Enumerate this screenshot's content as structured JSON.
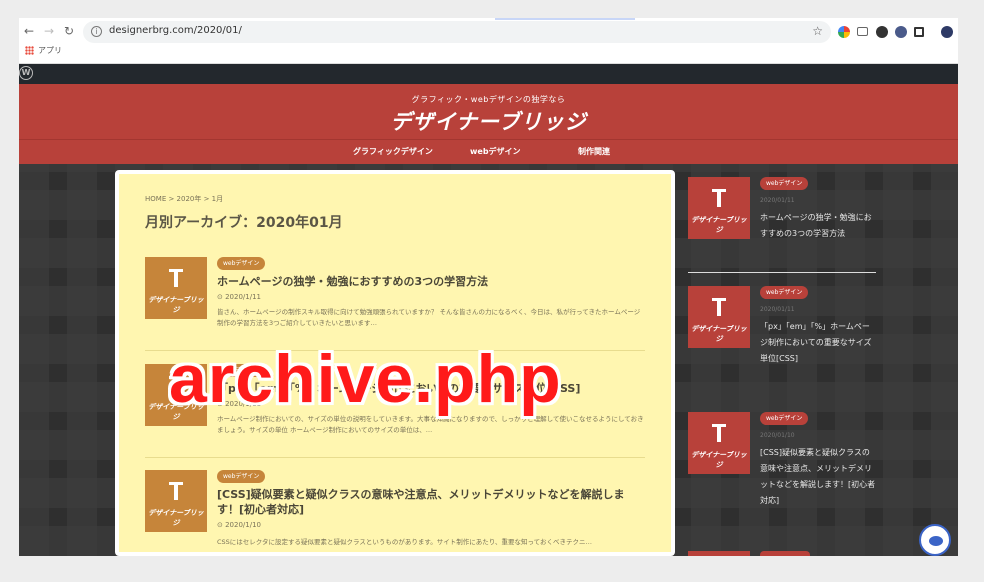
{
  "browser": {
    "url": "designerbrg.com/2020/01/",
    "bookmark_apps": "アプリ"
  },
  "site": {
    "tagline": "グラフィック・webデザインの独学なら",
    "logo": "デザイナーブリッジ",
    "nav": [
      "グラフィックデザイン",
      "webデザイン",
      "制作関連"
    ]
  },
  "main": {
    "breadcrumb": "HOME > 2020年 > 1月",
    "archive_title": "月別アーカイブ：2020年01月",
    "posts": [
      {
        "category": "webデザイン",
        "title": "ホームページの独学・勉強におすすめの3つの学習方法",
        "date": "2020/1/11",
        "excerpt": "皆さん、ホームページの制作スキル取得に向けて勉強頑張られていますか？ そんな皆さんの力になるべく、今日は、私が行ってきたホームページ制作の学習方法を3つご紹介していきたいと思います…",
        "thumb_brand": "デザイナーブリッジ"
      },
      {
        "category": "webデザイン",
        "title": "「px」「em」「%」ホームページ制作においての重要なサイズ単位[CSS]",
        "date": "2020/1/11",
        "excerpt": "ホームページ制作においての、サイズの単位の説明をしていきます。大事な知識になりますので、しっかりと理解して使いこなせるようにしておきましょう。サイズの単位 ホームページ制作においてのサイズの単位は、…",
        "thumb_brand": "デザイナーブリッジ"
      },
      {
        "category": "webデザイン",
        "title": "[CSS]疑似要素と疑似クラスの意味や注意点、メリットデメリットなどを解説します！[初心者対応]",
        "date": "2020/1/10",
        "excerpt": "CSSにはセレクタに設定する疑似要素と疑似クラスというものがあります。サイト制作にあたり、重要な知っておくべきテクニ…",
        "thumb_brand": "デザイナーブリッジ"
      }
    ]
  },
  "overlay_text": "archive.php",
  "sidebar": {
    "items": [
      {
        "category": "webデザイン",
        "date": "2020/01/11",
        "title": "ホームページの独学・勉強におすすめの3つの学習方法",
        "thumb_brand": "デザイナーブリッジ"
      },
      {
        "category": "webデザイン",
        "date": "2020/01/11",
        "title": "「px」「em」「%」ホームページ制作においての重要なサイズ単位[CSS]",
        "thumb_brand": "デザイナーブリッジ"
      },
      {
        "category": "webデザイン",
        "date": "2020/01/10",
        "title": "[CSS]疑似要素と疑似クラスの意味や注意点、メリットデメリットなどを解説します！[初心者対応]",
        "thumb_brand": "デザイナーブリッジ"
      }
    ]
  },
  "colors": {
    "header_red": "#b8413a",
    "main_bg": "#fff6b0",
    "thumb_orange": "#c6853a",
    "overlay_red": "#ff1a1a"
  }
}
